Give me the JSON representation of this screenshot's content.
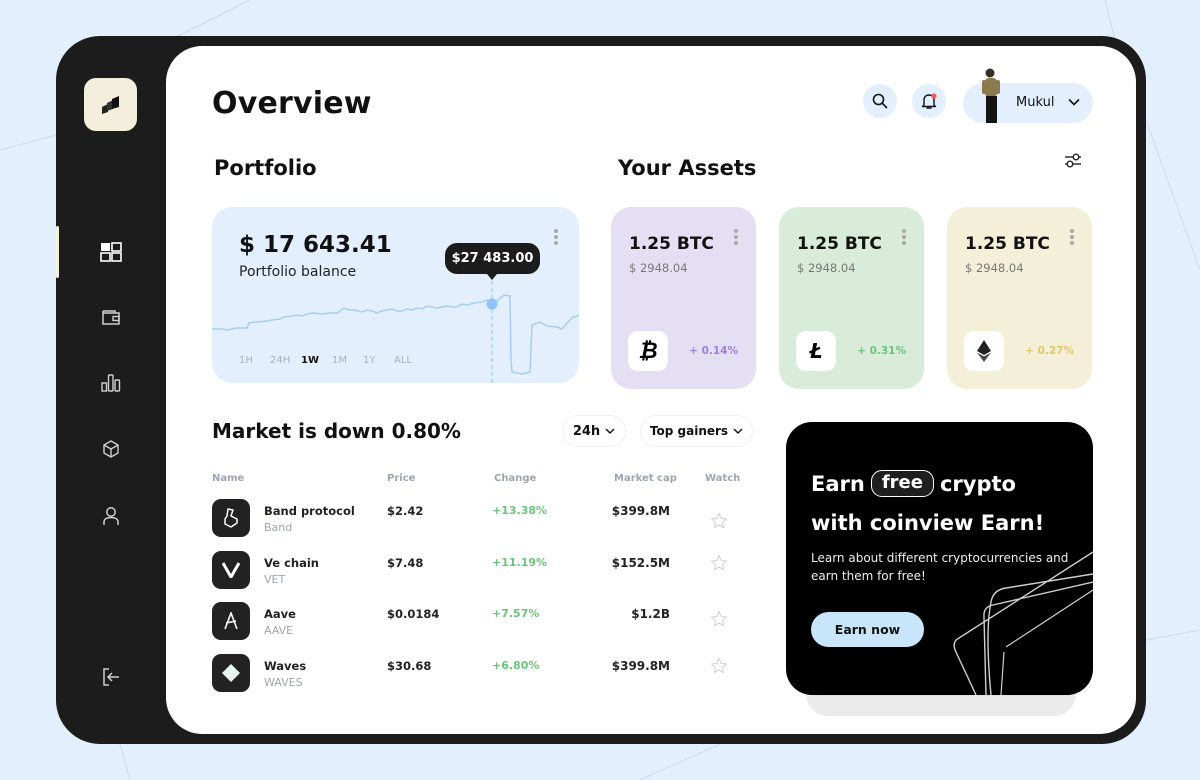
{
  "app": {
    "title": "Overview"
  },
  "sidebar": {
    "items": [
      {
        "name": "dashboard",
        "icon": "grid-icon",
        "active": true
      },
      {
        "name": "wallet",
        "icon": "wallet-icon",
        "active": false
      },
      {
        "name": "analytics",
        "icon": "bar-chart-icon",
        "active": false
      },
      {
        "name": "products",
        "icon": "cube-icon",
        "active": false
      },
      {
        "name": "profile",
        "icon": "user-icon",
        "active": false
      }
    ],
    "logout_icon": "logout-icon"
  },
  "header": {
    "search_icon": "search-icon",
    "notification_icon": "bell-icon",
    "user": {
      "name": "Mukul"
    }
  },
  "portfolio": {
    "title": "Portfolio",
    "balance": "$ 17 643.41",
    "balance_label": "Portfolio balance",
    "tooltip_value": "$27 483.00",
    "ranges": [
      "1H",
      "24H",
      "1W",
      "1M",
      "1Y",
      "ALL"
    ],
    "active_range": "1W"
  },
  "assets": {
    "title": "Your Assets",
    "cards": [
      {
        "amount": "1.25 BTC",
        "usd": "$ 2948.04",
        "change": "+ 0.14%",
        "icon": "bitcoin-icon",
        "glyph": "₿",
        "bg": "#e5dff3",
        "accent": "#a07ee6"
      },
      {
        "amount": "1.25 BTC",
        "usd": "$ 2948.04",
        "change": "+ 0.31%",
        "icon": "litecoin-icon",
        "glyph": "Ł",
        "bg": "#d8ecd9",
        "accent": "#6cc47c"
      },
      {
        "amount": "1.25 BTC",
        "usd": "$ 2948.04",
        "change": "+ 0.27%",
        "icon": "ethereum-icon",
        "glyph": "◆",
        "bg": "#f4efd8",
        "accent": "#e2c868"
      }
    ]
  },
  "market": {
    "title": "Market is  down 0.80%",
    "period_select": "24h",
    "sort_select": "Top gainers",
    "columns": [
      "Name",
      "Price",
      "Change",
      "Market cap",
      "Watch"
    ],
    "rows": [
      {
        "name": "Band protocol",
        "symbol": "Band",
        "price": "$2.42",
        "change": "+13.38%",
        "market_cap": "$399.8M",
        "icon": "band-protocol-icon"
      },
      {
        "name": "Ve chain",
        "symbol": "VET",
        "price": "$7.48",
        "change": "+11.19%",
        "market_cap": "$152.5M",
        "icon": "vechain-icon"
      },
      {
        "name": "Aave",
        "symbol": "AAVE",
        "price": "$0.0184",
        "change": "+7.57%",
        "market_cap": "$1.2B",
        "icon": "aave-icon"
      },
      {
        "name": "Waves",
        "symbol": "WAVES",
        "price": "$30.68",
        "change": "+6.80%",
        "market_cap": "$399.8M",
        "icon": "waves-icon"
      }
    ]
  },
  "promo": {
    "line1_a": "Earn",
    "line1_pill": "free",
    "line1_b": "crypto",
    "line2": "with coinview Earn!",
    "text": "Learn about different cryptocurrencies and earn them for free!",
    "button": "Earn now"
  },
  "colors": {
    "background": "#e3effd",
    "device": "#1c1c1c",
    "accent_blue": "#c9e5fa",
    "positive": "#6cc47c"
  }
}
